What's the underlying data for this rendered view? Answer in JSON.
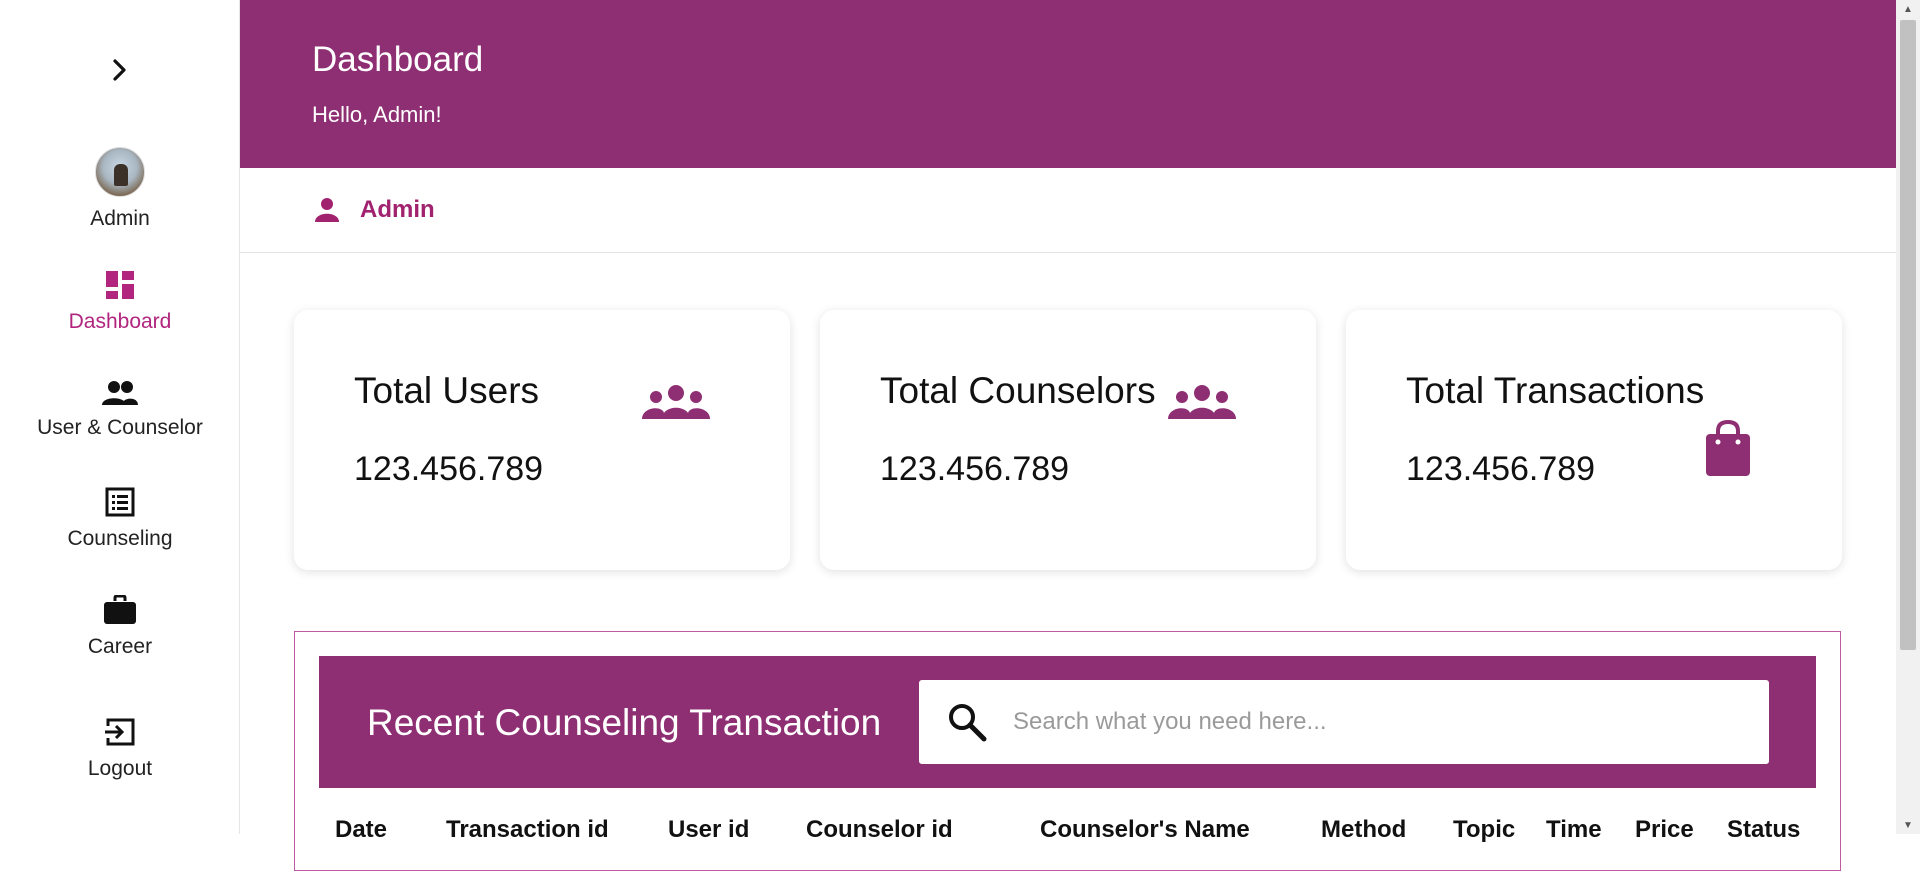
{
  "sidebar": {
    "items": [
      {
        "label": "Admin",
        "icon": "avatar"
      },
      {
        "label": "Dashboard",
        "icon": "dashboard-icon"
      },
      {
        "label": "User & Counselor",
        "icon": "people-icon"
      },
      {
        "label": "Counseling",
        "icon": "list-icon"
      },
      {
        "label": "Career",
        "icon": "briefcase-icon"
      },
      {
        "label": "Logout",
        "icon": "logout-icon"
      }
    ],
    "active": "Dashboard"
  },
  "header": {
    "title": "Dashboard",
    "greeting": "Hello, Admin!"
  },
  "userbar": {
    "name": "Admin"
  },
  "stats": [
    {
      "title": "Total Users",
      "value": "123.456.789",
      "icon": "group-icon"
    },
    {
      "title": "Total Counselors",
      "value": "123.456.789",
      "icon": "group-icon"
    },
    {
      "title": "Total Transactions",
      "value": "123.456.789",
      "icon": "shopping-bag-icon"
    }
  ],
  "transactions": {
    "title": "Recent Counseling Transaction",
    "search_placeholder": "Search what you need here...",
    "columns": [
      "Date",
      "Transaction id",
      "User id",
      "Counselor id",
      "Counselor's Name",
      "Method",
      "Topic",
      "Time",
      "Price",
      "Status"
    ]
  },
  "colors": {
    "primary": "#8f2f73",
    "accent": "#b1257f",
    "text": "#111111"
  }
}
